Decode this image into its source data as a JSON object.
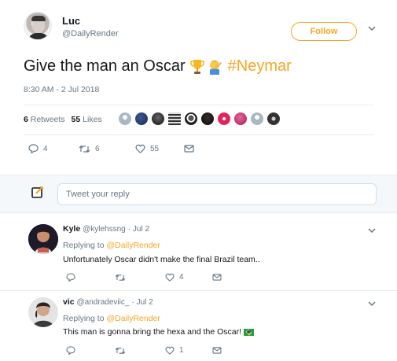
{
  "tweet": {
    "author_name": "Luc",
    "author_handle": "@DailyRender",
    "follow_label": "Follow",
    "text": "Give the man an Oscar",
    "hashtag": "#Neymar",
    "timestamp": "8:30 AM - 2 Jul 2018",
    "retweets_count": "6",
    "retweets_label": "Retweets",
    "likes_count": "55",
    "likes_label": "Likes",
    "actions": {
      "replies": "4",
      "retweets": "6",
      "likes": "55"
    }
  },
  "reply_composer": {
    "placeholder": "Tweet your reply"
  },
  "replies": [
    {
      "name": "Kyle",
      "handle": "@kylehssng",
      "date": "Jul 2",
      "replying_prefix": "Replying to",
      "replying_to": "@DailyRender",
      "text": "Unfortunately Oscar didn't make the final Brazil team..",
      "replies": "",
      "retweets": "",
      "likes": "4"
    },
    {
      "name": "vic",
      "handle": "@andradeviic_",
      "date": "Jul 2",
      "replying_prefix": "Replying to",
      "replying_to": "@DailyRender",
      "text": "This man is gonna bring the hexa and the Oscar!",
      "replies": "",
      "retweets": "",
      "likes": "1"
    }
  ],
  "colors": {
    "accent": "#f5a623",
    "muted": "#657786",
    "text": "#14171a",
    "border": "#e6ecf0"
  },
  "icons": [
    "chevron-down-icon",
    "trophy-icon",
    "facepalm-emoji-icon",
    "reply-icon",
    "retweet-icon",
    "heart-icon",
    "message-icon",
    "compose-icon",
    "brazil-flag-icon"
  ]
}
